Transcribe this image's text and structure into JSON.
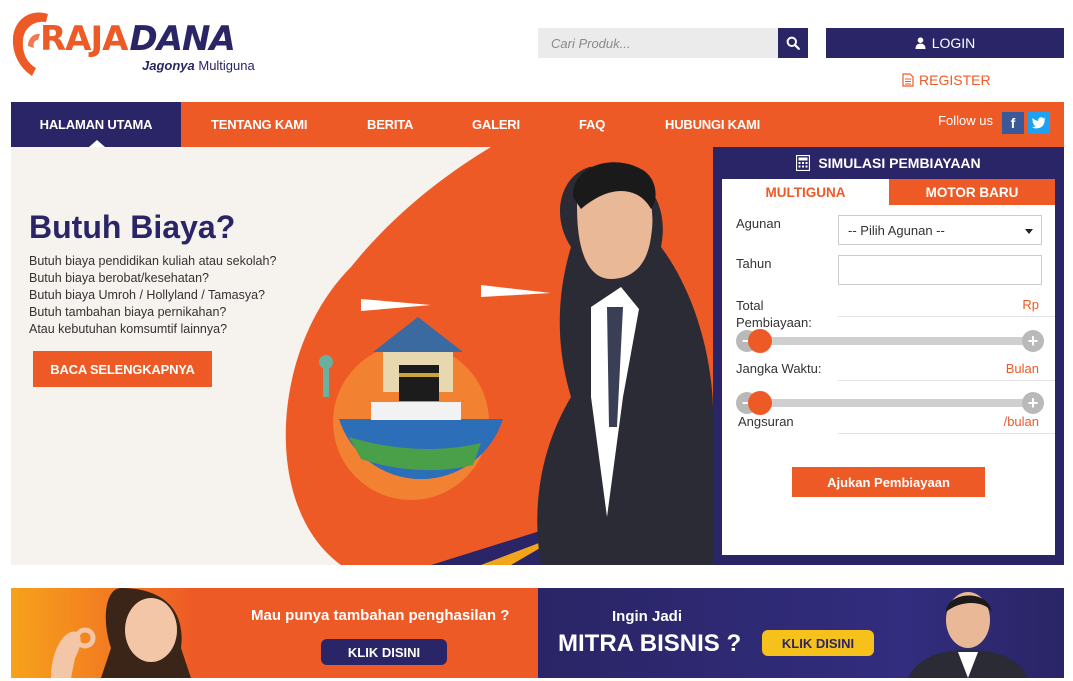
{
  "header": {
    "logo": {
      "brand_part1": "RAJA",
      "brand_part2": "DANA",
      "tagline_bold": "Jagonya",
      "tagline_rest": " Multiguna"
    },
    "search": {
      "placeholder": "Cari Produk...",
      "icon": "search-icon"
    },
    "login_label": "LOGIN",
    "register_label": "REGISTER"
  },
  "nav": {
    "items": [
      {
        "label": "HALAMAN UTAMA",
        "active": true
      },
      {
        "label": "TENTANG KAMI"
      },
      {
        "label": "BERITA"
      },
      {
        "label": "GALERI"
      },
      {
        "label": "FAQ"
      },
      {
        "label": "HUBUNGI KAMI"
      }
    ],
    "follow_label": "Follow us",
    "social": [
      {
        "icon": "facebook-icon",
        "glyph": "f"
      },
      {
        "icon": "twitter-icon"
      }
    ]
  },
  "hero": {
    "title": "Butuh Biaya?",
    "lines": [
      "Butuh biaya pendidikan kuliah atau sekolah?",
      "Butuh biaya berobat/kesehatan?",
      "Butuh biaya Umroh / Hollyland / Tamasya?",
      "Butuh tambahan biaya pernikahan?",
      "Atau kebutuhan komsumtif lainnya?"
    ],
    "button_label": "BACA SELENGKAPNYA"
  },
  "simulator": {
    "title": "SIMULASI PEMBIAYAAN",
    "tabs": [
      "MULTIGUNA",
      "MOTOR BARU"
    ],
    "agunan_label": "Agunan",
    "agunan_selected": "-- Pilih Agunan --",
    "tahun_label": "Tahun",
    "total_label": "Total Pembiayaan:",
    "total_unit": "Rp",
    "total_slider_value": 0,
    "jangka_label": "Jangka Waktu:",
    "jangka_unit": "Bulan",
    "jangka_slider_value": 0,
    "angsuran_label": "Angsuran",
    "angsuran_unit": "/bulan",
    "submit_label": "Ajukan Pembiayaan"
  },
  "banners": {
    "left": {
      "text": "Mau punya tambahan penghasilan ?",
      "button": "KLIK DISINI"
    },
    "right": {
      "small": "Ingin Jadi",
      "big": "MITRA BISNIS ?",
      "button": "KLIK DISINI"
    }
  },
  "colors": {
    "orange": "#ee5a26",
    "navy": "#2a2566",
    "yellow": "#f7c11b"
  }
}
